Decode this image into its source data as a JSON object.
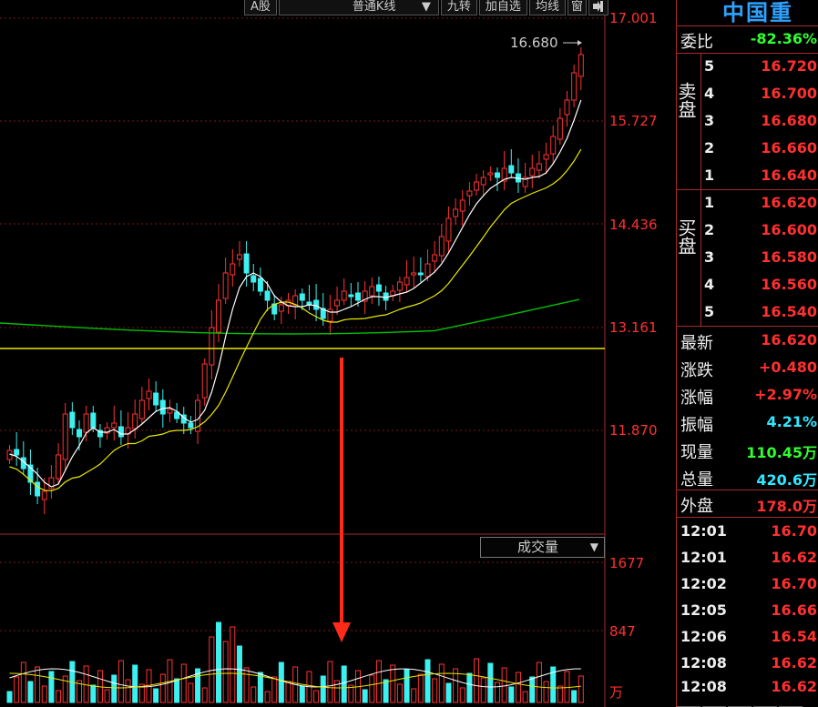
{
  "toolbar": {
    "items": [
      "A股",
      "普通K线",
      "九转",
      "加自选",
      "均线",
      "窗"
    ],
    "dropdown_arrow": "▼",
    "exit_icon": "exit-icon"
  },
  "chart": {
    "price_axis": [
      "17.001",
      "15.727",
      "14.436",
      "13.161",
      "11.870"
    ],
    "last_price_label": "16.680",
    "volume_axis": [
      "1677",
      "847",
      "万"
    ],
    "volume_selector": "成交量",
    "colors": {
      "up": "#ff3232",
      "down": "#3cf0f0",
      "ma5": "#ffffff",
      "ma10": "#e8e800",
      "ma20": "#00c000",
      "hline": "#e8e800",
      "arrow": "#ff2a1a"
    }
  },
  "panel": {
    "stock_name": "中国重",
    "weibi": {
      "label": "委比",
      "value": "-82.36%"
    },
    "sell_label": "卖盘",
    "buy_label": "买盘",
    "sell": [
      {
        "level": "5",
        "price": "16.720"
      },
      {
        "level": "4",
        "price": "16.700"
      },
      {
        "level": "3",
        "price": "16.680"
      },
      {
        "level": "2",
        "price": "16.660"
      },
      {
        "level": "1",
        "price": "16.640"
      }
    ],
    "buy": [
      {
        "level": "1",
        "price": "16.620"
      },
      {
        "level": "2",
        "price": "16.600"
      },
      {
        "level": "3",
        "price": "16.580"
      },
      {
        "level": "4",
        "price": "16.560"
      },
      {
        "level": "5",
        "price": "16.540"
      }
    ],
    "stats": [
      {
        "label": "最新",
        "value": "16.620",
        "color": "#ff3030"
      },
      {
        "label": "涨跌",
        "value": "+0.480",
        "color": "#ff3030"
      },
      {
        "label": "涨幅",
        "value": "+2.97%",
        "color": "#ff3030"
      },
      {
        "label": "振幅",
        "value": "4.21%",
        "color": "#30e8ff"
      },
      {
        "label": "现量",
        "value": "110.45万",
        "color": "#30ff30"
      },
      {
        "label": "总量",
        "value": "420.6万",
        "color": "#30e8ff"
      },
      {
        "label": "外盘",
        "value": "178.0万",
        "color": "#ff3030"
      }
    ],
    "ticks": [
      {
        "time": "12:01",
        "price": "16.70"
      },
      {
        "time": "12:01",
        "price": "16.62"
      },
      {
        "time": "12:02",
        "price": "16.70"
      },
      {
        "time": "12:05",
        "price": "16.66"
      },
      {
        "time": "12:06",
        "price": "16.54"
      },
      {
        "time": "12:08",
        "price": "16.62"
      },
      {
        "time": "12:08",
        "price": "16.62"
      }
    ]
  }
}
